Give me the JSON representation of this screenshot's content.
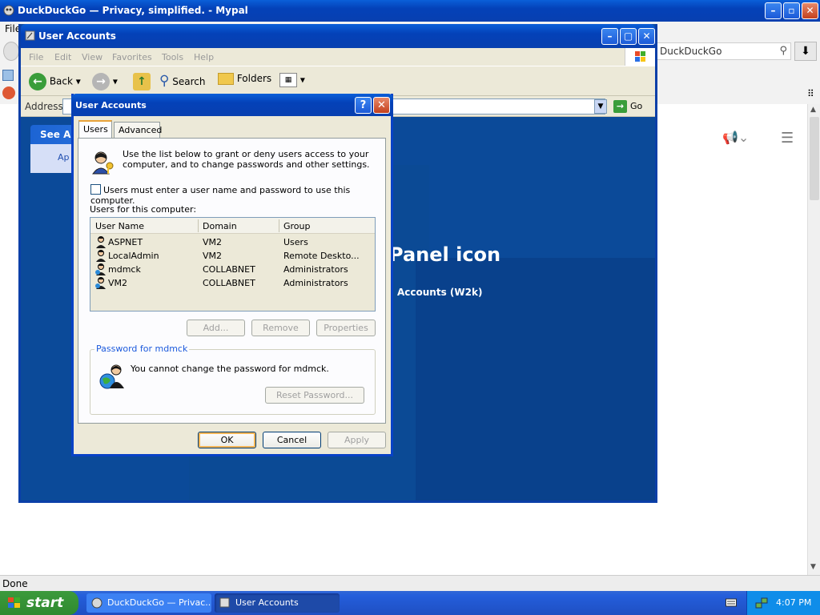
{
  "browser": {
    "title": "DuckDuckGo — Privacy, simplified. - Mypal",
    "menu_file": "File",
    "search_placeholder": "DuckDuckGo",
    "status": "Done"
  },
  "explorer": {
    "title": "User Accounts",
    "menu": [
      "File",
      "Edit",
      "View",
      "Favorites",
      "Tools",
      "Help"
    ],
    "toolbar": {
      "back": "Back",
      "search": "Search",
      "folders": "Folders"
    },
    "address_label": "Address",
    "go_label": "Go",
    "see_also": "See Al",
    "see_also_item": "Ap",
    "heading": "Panel icon",
    "subheading": "Accounts (W2k)"
  },
  "dialog": {
    "title": "User Accounts",
    "tabs": [
      "Users",
      "Advanced"
    ],
    "intro": "Use the list below to grant or deny users access to your computer, and to change passwords and other settings.",
    "checkbox_label": "Users must enter a user name and password to use this computer.",
    "checkbox_checked": false,
    "list_label": "Users for this computer:",
    "columns": [
      "User Name",
      "Domain",
      "Group"
    ],
    "rows": [
      {
        "name": "ASPNET",
        "domain": "VM2",
        "group": "Users"
      },
      {
        "name": "LocalAdmin",
        "domain": "VM2",
        "group": "Remote Deskto..."
      },
      {
        "name": "mdmck",
        "domain": "COLLABNET",
        "group": "Administrators"
      },
      {
        "name": "VM2",
        "domain": "COLLABNET",
        "group": "Administrators"
      }
    ],
    "buttons": {
      "add": "Add...",
      "remove": "Remove",
      "properties": "Properties"
    },
    "password_group_title": "Password for mdmck",
    "password_text": "You cannot change the password for mdmck.",
    "reset_password": "Reset Password...",
    "ok": "OK",
    "cancel": "Cancel",
    "apply": "Apply"
  },
  "taskbar": {
    "start": "start",
    "tasks": [
      "DuckDuckGo — Privac...",
      "User Accounts"
    ],
    "clock": "4:07 PM"
  },
  "colors": {
    "xp_blue": "#0a5fd8",
    "start_green": "#3c9a3c",
    "content_blue": "#0b4a99"
  }
}
